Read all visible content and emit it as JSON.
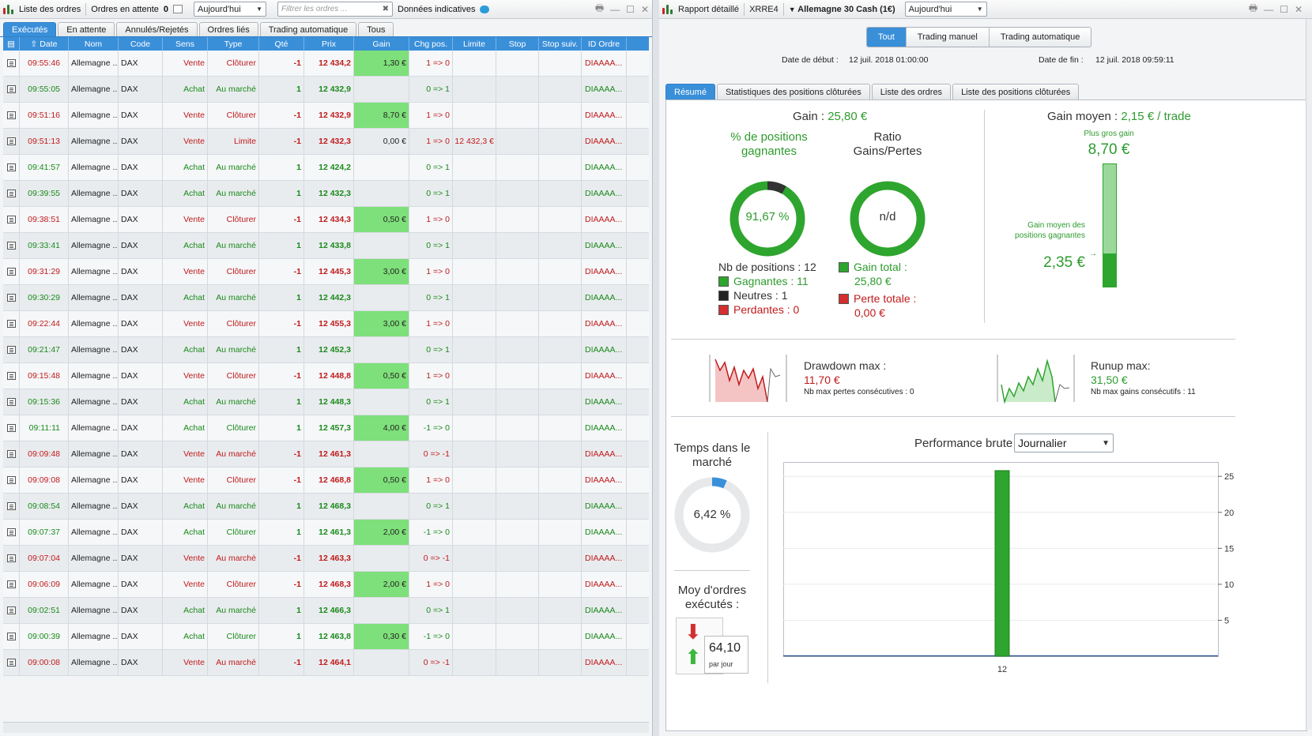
{
  "left": {
    "toolbar": {
      "title": "Liste des ordres",
      "pending_label": "Ordres en attente",
      "pending_count": "0",
      "period": "Aujourd'hui",
      "filter_placeholder": "Filtrer les ordres ...",
      "indicative": "Données indicatives"
    },
    "tabs": [
      "Exécutés",
      "En attente",
      "Annulés/Rejetés",
      "Ordres liés",
      "Trading automatique",
      "Tous"
    ],
    "columns": [
      "Date",
      "Nom",
      "Code",
      "Sens",
      "Type",
      "Qté",
      "Prix",
      "Gain",
      "Chg pos.",
      "Limite",
      "Stop",
      "Stop suiv.",
      "ID Ordre"
    ],
    "rows": [
      {
        "time": "09:55:46",
        "nom": "Allemagne ...",
        "code": "DAX",
        "sens": "Vente",
        "type": "Clôturer",
        "qte": "-1",
        "prix": "12 434,2",
        "gain": "1,30 €",
        "chg": "1 => 0",
        "limite": "",
        "id": "DIAAAA..."
      },
      {
        "time": "09:55:05",
        "nom": "Allemagne ...",
        "code": "DAX",
        "sens": "Achat",
        "type": "Au marché",
        "qte": "1",
        "prix": "12 432,9",
        "gain": "",
        "chg": "0 => 1",
        "limite": "",
        "id": "DIAAAA..."
      },
      {
        "time": "09:51:16",
        "nom": "Allemagne ...",
        "code": "DAX",
        "sens": "Vente",
        "type": "Clôturer",
        "qte": "-1",
        "prix": "12 432,9",
        "gain": "8,70 €",
        "chg": "1 => 0",
        "limite": "",
        "id": "DIAAAA..."
      },
      {
        "time": "09:51:13",
        "nom": "Allemagne ...",
        "code": "DAX",
        "sens": "Vente",
        "type": "Limite",
        "qte": "-1",
        "prix": "12 432,3",
        "gain": "0,00 €",
        "chg": "1 => 0",
        "limite": "12 432,3 €",
        "id": "DIAAAA..."
      },
      {
        "time": "09:41:57",
        "nom": "Allemagne ...",
        "code": "DAX",
        "sens": "Achat",
        "type": "Au marché",
        "qte": "1",
        "prix": "12 424,2",
        "gain": "",
        "chg": "0 => 1",
        "limite": "",
        "id": "DIAAAA..."
      },
      {
        "time": "09:39:55",
        "nom": "Allemagne ...",
        "code": "DAX",
        "sens": "Achat",
        "type": "Au marché",
        "qte": "1",
        "prix": "12 432,3",
        "gain": "",
        "chg": "0 => 1",
        "limite": "",
        "id": "DIAAAA..."
      },
      {
        "time": "09:38:51",
        "nom": "Allemagne ...",
        "code": "DAX",
        "sens": "Vente",
        "type": "Clôturer",
        "qte": "-1",
        "prix": "12 434,3",
        "gain": "0,50 €",
        "chg": "1 => 0",
        "limite": "",
        "id": "DIAAAA..."
      },
      {
        "time": "09:33:41",
        "nom": "Allemagne ...",
        "code": "DAX",
        "sens": "Achat",
        "type": "Au marché",
        "qte": "1",
        "prix": "12 433,8",
        "gain": "",
        "chg": "0 => 1",
        "limite": "",
        "id": "DIAAAA..."
      },
      {
        "time": "09:31:29",
        "nom": "Allemagne ...",
        "code": "DAX",
        "sens": "Vente",
        "type": "Clôturer",
        "qte": "-1",
        "prix": "12 445,3",
        "gain": "3,00 €",
        "chg": "1 => 0",
        "limite": "",
        "id": "DIAAAA..."
      },
      {
        "time": "09:30:29",
        "nom": "Allemagne ...",
        "code": "DAX",
        "sens": "Achat",
        "type": "Au marché",
        "qte": "1",
        "prix": "12 442,3",
        "gain": "",
        "chg": "0 => 1",
        "limite": "",
        "id": "DIAAAA..."
      },
      {
        "time": "09:22:44",
        "nom": "Allemagne ...",
        "code": "DAX",
        "sens": "Vente",
        "type": "Clôturer",
        "qte": "-1",
        "prix": "12 455,3",
        "gain": "3,00 €",
        "chg": "1 => 0",
        "limite": "",
        "id": "DIAAAA..."
      },
      {
        "time": "09:21:47",
        "nom": "Allemagne ...",
        "code": "DAX",
        "sens": "Achat",
        "type": "Au marché",
        "qte": "1",
        "prix": "12 452,3",
        "gain": "",
        "chg": "0 => 1",
        "limite": "",
        "id": "DIAAAA..."
      },
      {
        "time": "09:15:48",
        "nom": "Allemagne ...",
        "code": "DAX",
        "sens": "Vente",
        "type": "Clôturer",
        "qte": "-1",
        "prix": "12 448,8",
        "gain": "0,50 €",
        "chg": "1 => 0",
        "limite": "",
        "id": "DIAAAA..."
      },
      {
        "time": "09:15:36",
        "nom": "Allemagne ...",
        "code": "DAX",
        "sens": "Achat",
        "type": "Au marché",
        "qte": "1",
        "prix": "12 448,3",
        "gain": "",
        "chg": "0 => 1",
        "limite": "",
        "id": "DIAAAA..."
      },
      {
        "time": "09:11:11",
        "nom": "Allemagne ...",
        "code": "DAX",
        "sens": "Achat",
        "type": "Clôturer",
        "qte": "1",
        "prix": "12 457,3",
        "gain": "4,00 €",
        "chg": "-1 => 0",
        "limite": "",
        "id": "DIAAAA..."
      },
      {
        "time": "09:09:48",
        "nom": "Allemagne ...",
        "code": "DAX",
        "sens": "Vente",
        "type": "Au marché",
        "qte": "-1",
        "prix": "12 461,3",
        "gain": "",
        "chg": "0 => -1",
        "limite": "",
        "id": "DIAAAA..."
      },
      {
        "time": "09:09:08",
        "nom": "Allemagne ...",
        "code": "DAX",
        "sens": "Vente",
        "type": "Clôturer",
        "qte": "-1",
        "prix": "12 468,8",
        "gain": "0,50 €",
        "chg": "1 => 0",
        "limite": "",
        "id": "DIAAAA..."
      },
      {
        "time": "09:08:54",
        "nom": "Allemagne ...",
        "code": "DAX",
        "sens": "Achat",
        "type": "Au marché",
        "qte": "1",
        "prix": "12 468,3",
        "gain": "",
        "chg": "0 => 1",
        "limite": "",
        "id": "DIAAAA..."
      },
      {
        "time": "09:07:37",
        "nom": "Allemagne ...",
        "code": "DAX",
        "sens": "Achat",
        "type": "Clôturer",
        "qte": "1",
        "prix": "12 461,3",
        "gain": "2,00 €",
        "chg": "-1 => 0",
        "limite": "",
        "id": "DIAAAA..."
      },
      {
        "time": "09:07:04",
        "nom": "Allemagne ...",
        "code": "DAX",
        "sens": "Vente",
        "type": "Au marché",
        "qte": "-1",
        "prix": "12 463,3",
        "gain": "",
        "chg": "0 => -1",
        "limite": "",
        "id": "DIAAAA..."
      },
      {
        "time": "09:06:09",
        "nom": "Allemagne ...",
        "code": "DAX",
        "sens": "Vente",
        "type": "Clôturer",
        "qte": "-1",
        "prix": "12 468,3",
        "gain": "2,00 €",
        "chg": "1 => 0",
        "limite": "",
        "id": "DIAAAA..."
      },
      {
        "time": "09:02:51",
        "nom": "Allemagne ...",
        "code": "DAX",
        "sens": "Achat",
        "type": "Au marché",
        "qte": "1",
        "prix": "12 466,3",
        "gain": "",
        "chg": "0 => 1",
        "limite": "",
        "id": "DIAAAA..."
      },
      {
        "time": "09:00:39",
        "nom": "Allemagne ...",
        "code": "DAX",
        "sens": "Achat",
        "type": "Clôturer",
        "qte": "1",
        "prix": "12 463,8",
        "gain": "0,30 €",
        "chg": "-1 => 0",
        "limite": "",
        "id": "DIAAAA..."
      },
      {
        "time": "09:00:08",
        "nom": "Allemagne ...",
        "code": "DAX",
        "sens": "Vente",
        "type": "Au marché",
        "qte": "-1",
        "prix": "12 464,1",
        "gain": "",
        "chg": "0 => -1",
        "limite": "",
        "id": "DIAAAA..."
      }
    ]
  },
  "right": {
    "toolbar": {
      "title": "Rapport détaillé",
      "account": "XRRE4",
      "instrument": "Allemagne 30 Cash (1€)",
      "period": "Aujourd'hui"
    },
    "segments": [
      "Tout",
      "Trading manuel",
      "Trading automatique"
    ],
    "date_start_label": "Date de début :",
    "date_start": "12 juil. 2018 01:00:00",
    "date_end_label": "Date de fin :",
    "date_end": "12 juil. 2018 09:59:11",
    "tabs": [
      "Résumé",
      "Statistiques des positions clôturées",
      "Liste des ordres",
      "Liste des positions clôturées"
    ],
    "summary": {
      "gain_label": "Gain :",
      "gain_value": "25,80 €",
      "pct_title": "% de positions gagnantes",
      "pct_value": "91,67 %",
      "pct_fraction": 0.9167,
      "ratio_title": "Ratio Gains/Pertes",
      "ratio_value": "n/d",
      "nb_positions": "Nb de positions : 12",
      "gagnantes": "Gagnantes : 11",
      "neutres": "Neutres : 1",
      "perdantes": "Perdantes : 0",
      "gain_total_label": "Gain total :",
      "gain_total_value": "25,80 €",
      "perte_totale_label": "Perte totale :",
      "perte_totale_value": "0,00 €",
      "gain_moyen_label": "Gain moyen :",
      "gain_moyen_value": "2,15 € / trade",
      "plus_gros_gain_label": "Plus gros gain",
      "plus_gros_gain_value": "8,70 €",
      "gain_moyen_gagnantes_label": "Gain moyen des positions gagnantes",
      "gain_moyen_gagnantes_value": "2,35 €",
      "gain_moyen_fraction": 0.27,
      "drawdown_label": "Drawdown max :",
      "drawdown_value": "11,70 €",
      "drawdown_sub": "Nb max pertes consécutives : 0",
      "runup_label": "Runup max:",
      "runup_value": "31,50 €",
      "runup_sub": "Nb max gains consécutifs : 11",
      "temps_title": "Temps dans le marché",
      "temps_value": "6,42 %",
      "temps_fraction": 0.0642,
      "moy_title": "Moy d'ordres exécutés :",
      "moy_value": "64,10",
      "moy_unit": "par jour",
      "perf_title": "Performance brute",
      "perf_period": "Journalier"
    },
    "colors": {
      "green": "#2ea52e",
      "red": "#c11b1b",
      "blue": "#3a8fd9"
    }
  },
  "chart_data": {
    "type": "bar",
    "title": "Performance brute",
    "categories": [
      "12"
    ],
    "values": [
      25.8
    ],
    "ylim": [
      0,
      27
    ],
    "yticks": [
      "5",
      "10",
      "15",
      "20",
      "25"
    ],
    "grid": true
  }
}
